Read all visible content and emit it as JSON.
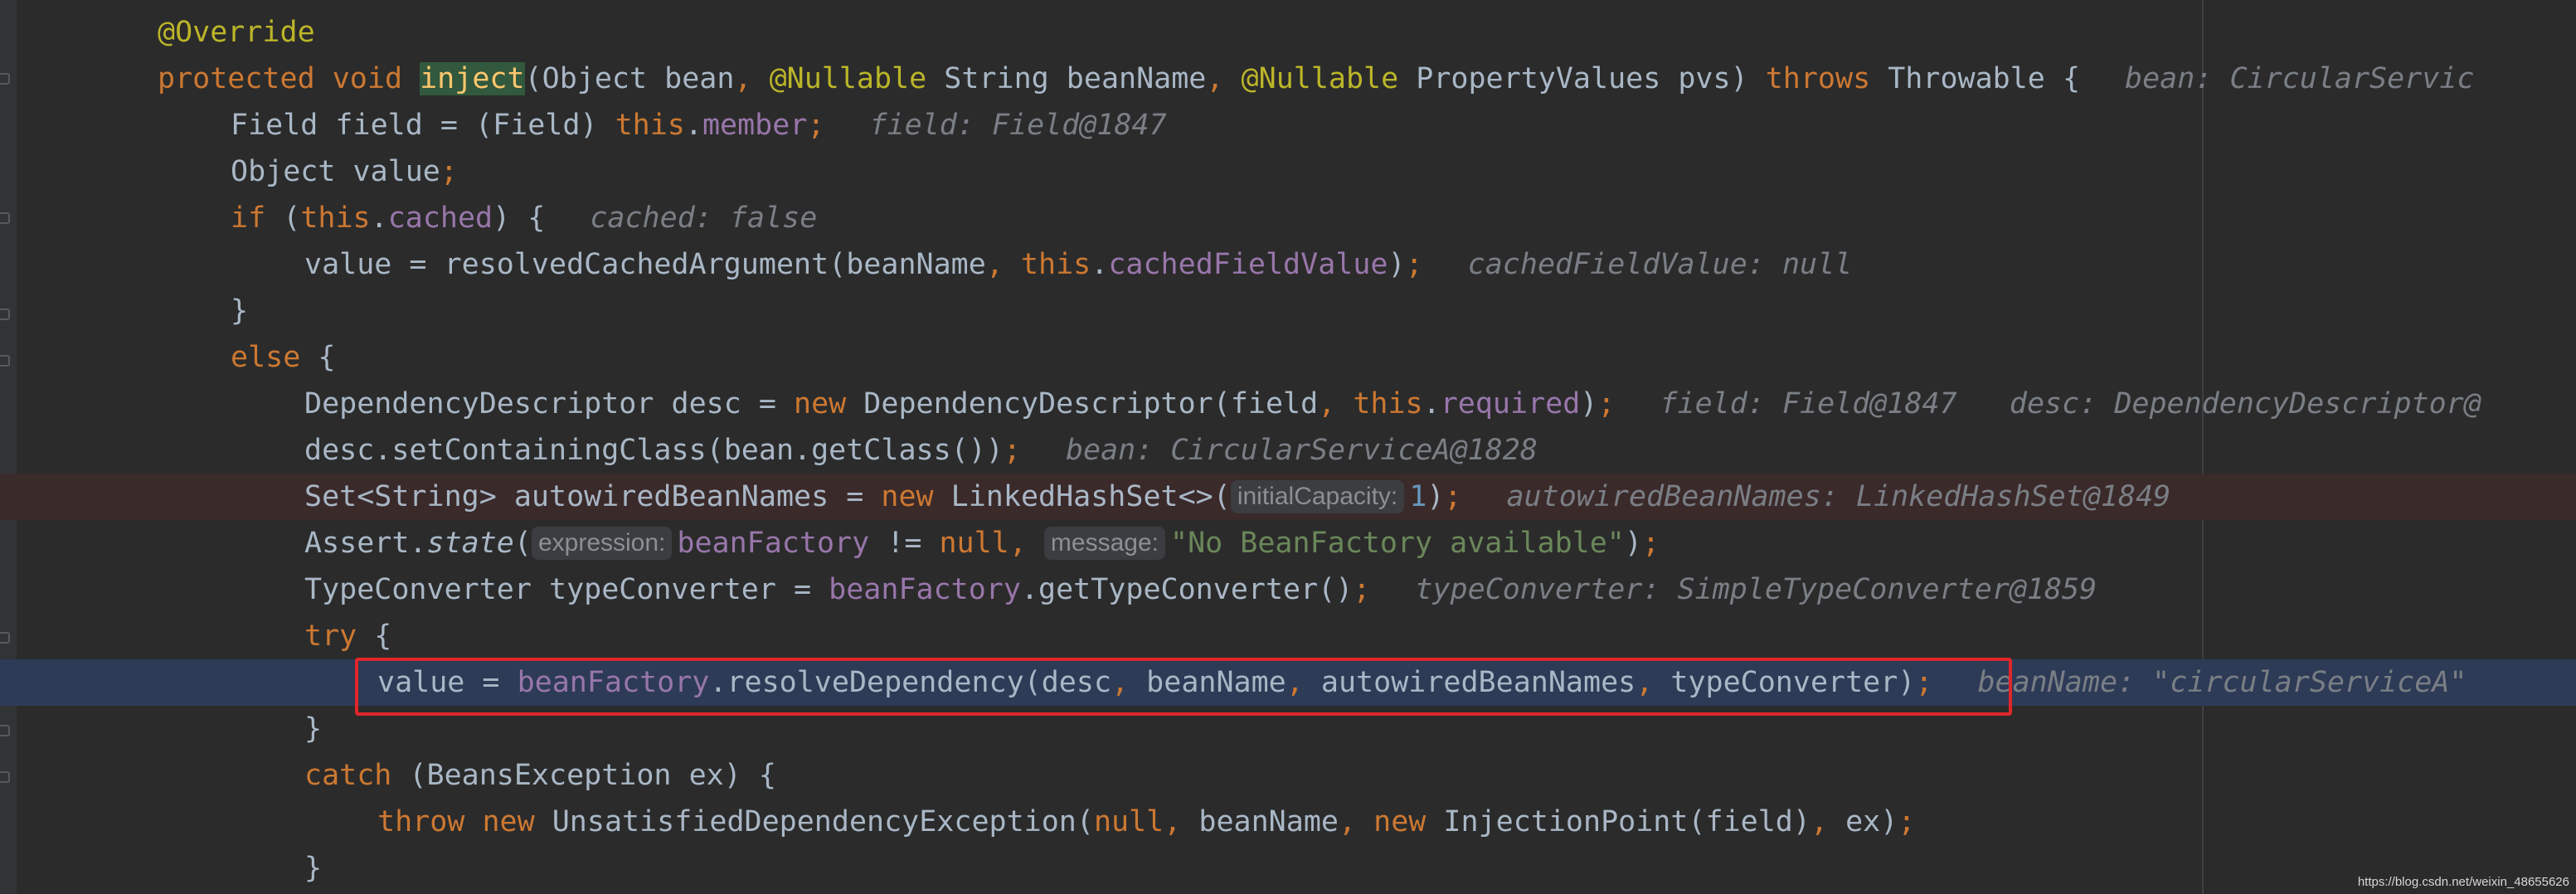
{
  "watermark": "https://blog.csdn.net/weixin_48655626",
  "colors": {
    "background": "#2b2b2b",
    "keyword": "#cc7832",
    "annotation": "#bbb529",
    "field": "#9876aa",
    "string": "#6a8759",
    "number": "#6897bb",
    "hint": "#7a7e85",
    "execution_line": "#2d3b57",
    "breakpoint_line": "#3b2a2a",
    "exec_box_border": "#e0262a"
  },
  "lines": [
    {
      "tokens": [
        {
          "t": "@Override",
          "c": "ann"
        }
      ]
    },
    {
      "tokens": [
        {
          "t": "protected",
          "c": "kw"
        },
        {
          "t": " "
        },
        {
          "t": "void",
          "c": "kw"
        },
        {
          "t": " "
        },
        {
          "t": "inject",
          "c": "hl-green"
        },
        {
          "t": "(Object bean"
        },
        {
          "t": ",",
          "c": "kw"
        },
        {
          "t": " "
        },
        {
          "t": "@Nullable",
          "c": "ann"
        },
        {
          "t": " String beanName"
        },
        {
          "t": ",",
          "c": "kw"
        },
        {
          "t": " "
        },
        {
          "t": "@Nullable",
          "c": "ann"
        },
        {
          "t": " PropertyValues pvs) "
        },
        {
          "t": "throws",
          "c": "kw"
        },
        {
          "t": " Throwable {"
        }
      ],
      "hint": "bean: CircularServic"
    },
    {
      "tokens": [
        {
          "t": "Field field = (Field) "
        },
        {
          "t": "this",
          "c": "kw"
        },
        {
          "t": "."
        },
        {
          "t": "member",
          "c": "fld"
        },
        {
          "t": ";",
          "c": "kw"
        }
      ],
      "hint": "field: Field@1847"
    },
    {
      "tokens": [
        {
          "t": "Object value"
        },
        {
          "t": ";",
          "c": "kw"
        }
      ]
    },
    {
      "tokens": [
        {
          "t": "if",
          "c": "kw"
        },
        {
          "t": " ("
        },
        {
          "t": "this",
          "c": "kw"
        },
        {
          "t": "."
        },
        {
          "t": "cached",
          "c": "fld"
        },
        {
          "t": ") {"
        }
      ],
      "hint": "cached: false"
    },
    {
      "tokens": [
        {
          "t": "value = resolvedCachedArgument(beanName"
        },
        {
          "t": ",",
          "c": "kw"
        },
        {
          "t": " "
        },
        {
          "t": "this",
          "c": "kw"
        },
        {
          "t": "."
        },
        {
          "t": "cachedFieldValue",
          "c": "fld"
        },
        {
          "t": ")"
        },
        {
          "t": ";",
          "c": "kw"
        }
      ],
      "hint": "cachedFieldValue: null"
    },
    {
      "tokens": [
        {
          "t": "}"
        }
      ]
    },
    {
      "tokens": [
        {
          "t": "else",
          "c": "kw"
        },
        {
          "t": " {"
        }
      ]
    },
    {
      "tokens": [
        {
          "t": "DependencyDescriptor desc = "
        },
        {
          "t": "new",
          "c": "kw"
        },
        {
          "t": " DependencyDescriptor(field"
        },
        {
          "t": ",",
          "c": "kw"
        },
        {
          "t": " "
        },
        {
          "t": "this",
          "c": "kw"
        },
        {
          "t": "."
        },
        {
          "t": "required",
          "c": "fld"
        },
        {
          "t": ")"
        },
        {
          "t": ";",
          "c": "kw"
        }
      ],
      "hint": "field: Field@1847   desc: DependencyDescriptor@"
    },
    {
      "tokens": [
        {
          "t": "desc.setContainingClass(bean.getClass())"
        },
        {
          "t": ";",
          "c": "kw"
        }
      ],
      "hint": "bean: CircularServiceA@1828"
    },
    {
      "tokens": [
        {
          "t": "Set<String> autowiredBeanNames = "
        },
        {
          "t": "new",
          "c": "kw"
        },
        {
          "t": " LinkedHashSet<>("
        },
        {
          "t": "initialCapacity:",
          "c": "param-hint"
        },
        {
          "t": "1",
          "c": "num"
        },
        {
          "t": ")"
        },
        {
          "t": ";",
          "c": "kw"
        }
      ],
      "hint": "autowiredBeanNames: LinkedHashSet@1849"
    },
    {
      "tokens": [
        {
          "t": "Assert."
        },
        {
          "t": "state",
          "c": "it"
        },
        {
          "t": "("
        },
        {
          "t": "expression:",
          "c": "param-hint"
        },
        {
          "t": "beanFactory",
          "c": "fld"
        },
        {
          "t": " != "
        },
        {
          "t": "null",
          "c": "kw"
        },
        {
          "t": ",",
          "c": "kw"
        },
        {
          "t": " "
        },
        {
          "t": "message:",
          "c": "param-hint"
        },
        {
          "t": "\"No BeanFactory available\"",
          "c": "str"
        },
        {
          "t": ")"
        },
        {
          "t": ";",
          "c": "kw"
        }
      ]
    },
    {
      "tokens": [
        {
          "t": "TypeConverter typeConverter = "
        },
        {
          "t": "beanFactory",
          "c": "fld"
        },
        {
          "t": ".getTypeConverter()"
        },
        {
          "t": ";",
          "c": "kw"
        }
      ],
      "hint": "typeConverter: SimpleTypeConverter@1859"
    },
    {
      "tokens": [
        {
          "t": "try",
          "c": "kw"
        },
        {
          "t": " {"
        }
      ]
    },
    {
      "tokens": [
        {
          "t": "value = "
        },
        {
          "t": "beanFactory",
          "c": "fld"
        },
        {
          "t": ".resolveDependency(desc"
        },
        {
          "t": ",",
          "c": "kw"
        },
        {
          "t": " beanName"
        },
        {
          "t": ",",
          "c": "kw"
        },
        {
          "t": " autowiredBeanNames"
        },
        {
          "t": ",",
          "c": "kw"
        },
        {
          "t": " typeConverter)"
        },
        {
          "t": ";",
          "c": "kw"
        }
      ],
      "hint": "beanName: \"circularServiceA\""
    },
    {
      "tokens": [
        {
          "t": "}"
        }
      ]
    },
    {
      "tokens": [
        {
          "t": "catch",
          "c": "kw"
        },
        {
          "t": " (BeansException ex) {"
        }
      ]
    },
    {
      "tokens": [
        {
          "t": "throw",
          "c": "kw"
        },
        {
          "t": " "
        },
        {
          "t": "new",
          "c": "kw"
        },
        {
          "t": " UnsatisfiedDependencyException("
        },
        {
          "t": "null",
          "c": "kw"
        },
        {
          "t": ",",
          "c": "kw"
        },
        {
          "t": " beanName"
        },
        {
          "t": ",",
          "c": "kw"
        },
        {
          "t": " "
        },
        {
          "t": "new",
          "c": "kw"
        },
        {
          "t": " InjectionPoint(field)"
        },
        {
          "t": ",",
          "c": "kw"
        },
        {
          "t": " ex)"
        },
        {
          "t": ";",
          "c": "kw"
        }
      ]
    },
    {
      "tokens": [
        {
          "t": "}"
        }
      ]
    }
  ]
}
